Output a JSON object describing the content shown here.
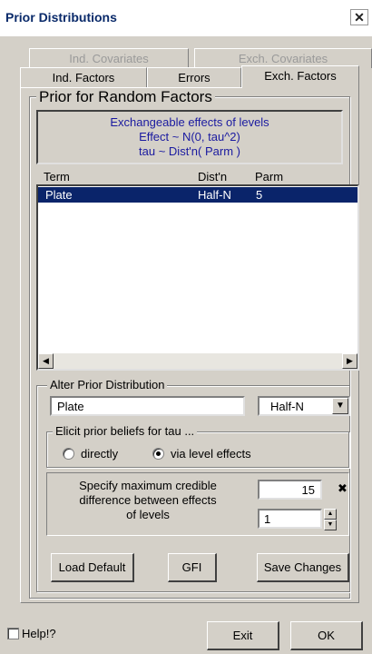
{
  "window": {
    "title": "Prior Distributions",
    "close_glyph": "✕"
  },
  "tabs": {
    "row1": [
      {
        "label": "Ind. Covariates",
        "state": "disabled"
      },
      {
        "label": "Exch. Covariates",
        "state": "disabled"
      }
    ],
    "row2": [
      {
        "label": "Ind. Factors",
        "state": "normal"
      },
      {
        "label": "Errors",
        "state": "normal"
      },
      {
        "label": "Exch. Factors",
        "state": "active"
      }
    ]
  },
  "prior_group": {
    "title": "Prior for Random Factors",
    "description": [
      "Exchangeable effects of levels",
      "Effect  ~  N(0, tau^2)",
      "tau ~ Dist'n( Parm )"
    ]
  },
  "table": {
    "headers": [
      "Term",
      "Dist'n",
      "Parm"
    ],
    "rows": [
      {
        "term": "Plate",
        "distn": "Half-N",
        "parm": "5",
        "selected": true
      }
    ]
  },
  "alter": {
    "title": "Alter Prior Distribution",
    "term_value": "Plate",
    "dist_value": "Half-N"
  },
  "elicit": {
    "title": "Elicit prior beliefs for tau ...",
    "options": [
      {
        "label": "directly",
        "checked": false
      },
      {
        "label": "via level effects",
        "checked": true
      }
    ]
  },
  "specify": {
    "text": [
      "Specify maximum credible",
      "difference between effects",
      "of levels"
    ],
    "max_value": "15",
    "clear_glyph": "✖",
    "levels_value": "1"
  },
  "buttons": {
    "load_default": "Load Default",
    "gfi": "GFI",
    "save_changes": "Save Changes"
  },
  "footer": {
    "help_label": "Help!?",
    "exit": "Exit",
    "ok": "OK"
  },
  "colors": {
    "selection": "#0a246a",
    "description_text": "#1a1aa0",
    "face": "#d4d0c8"
  }
}
